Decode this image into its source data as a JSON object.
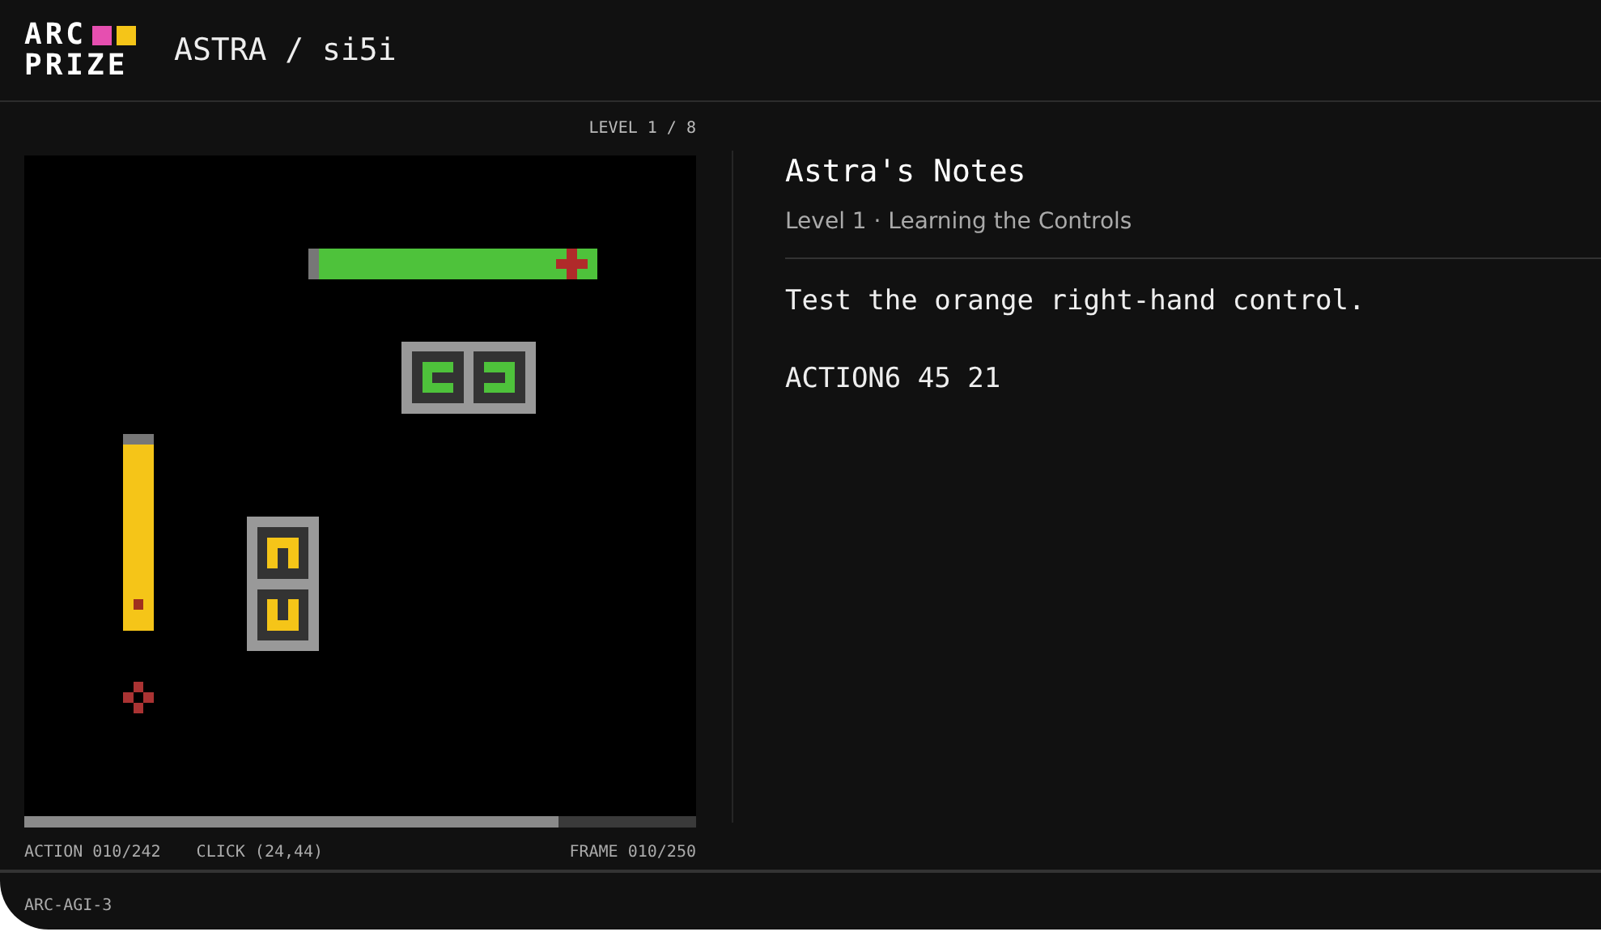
{
  "header": {
    "logo": [
      "ARC",
      "PRIZE"
    ],
    "title": "ASTRA / si5i"
  },
  "game": {
    "level_label": "LEVEL 1 / 8",
    "progress": {
      "level": 0.795
    },
    "stats": [
      "ACTION 010/242",
      "CLICK (24,44)",
      "FRAME 010/250"
    ]
  },
  "notes": {
    "title": "Astra's Notes",
    "subtitle": "Level 1 · Learning the Controls",
    "lines": [
      "Test the orange right-hand control.",
      "ACTION6 45 21"
    ]
  },
  "footer": {
    "label": "ARC-AGI-3"
  }
}
